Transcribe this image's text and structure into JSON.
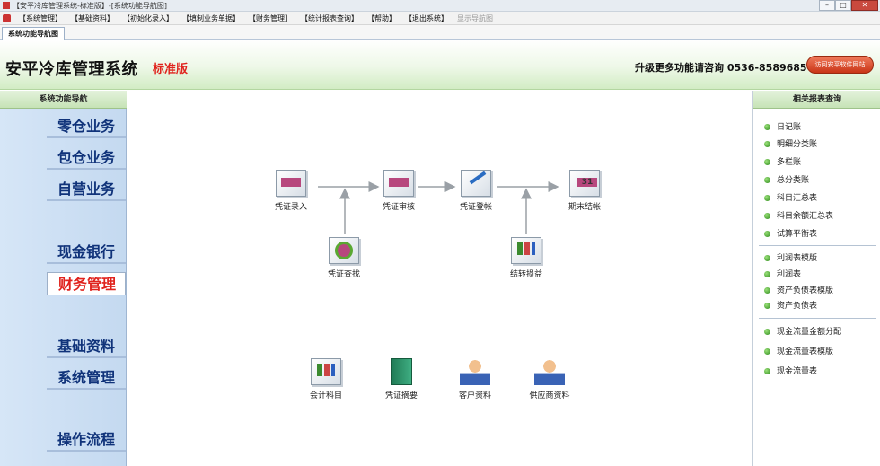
{
  "window": {
    "title": "【安平冷库管理系统-标准版】-[系统功能导航图]",
    "buttons": {
      "minimize": "–",
      "maximize": "□",
      "close": "✕"
    }
  },
  "menubar": {
    "items": [
      "【系统管理】",
      "【基础资料】",
      "【初始化录入】",
      "【填制业务单据】",
      "【财务管理】",
      "【统计报表查询】",
      "【帮助】",
      "【退出系统】",
      "显示导航图"
    ]
  },
  "tabs": {
    "active": "系统功能导航图"
  },
  "header": {
    "app_title": "安平冷库管理系统",
    "edition": "标准版",
    "phone_text": "升级更多功能请咨询 0536-8589685",
    "visit_button": "访问安平软件网站"
  },
  "left_nav": {
    "heading": "系统功能导航",
    "items": [
      "零仓业务",
      "包仓业务",
      "自营业务",
      "现金银行",
      "财务管理",
      "基础资料",
      "系统管理",
      "操作流程"
    ],
    "active": "财务管理"
  },
  "flow": {
    "nodes": {
      "voucher_entry": "凭证录入",
      "voucher_review": "凭证审核",
      "voucher_post": "凭证登帐",
      "period_close": "期末结帐",
      "voucher_query": "凭证查找",
      "carry_profit": "结转损益",
      "accounts": "会计科目",
      "voucher_summary": "凭证摘要",
      "customers": "客户资料",
      "suppliers": "供应商资料"
    },
    "icons": {
      "voucher_entry": "document-edit-icon",
      "voucher_review": "document-check-icon",
      "voucher_post": "pen-icon",
      "period_close": "calendar-icon",
      "voucher_query": "magnifier-icon",
      "carry_profit": "chart-icon",
      "accounts": "ledger-icon",
      "voucher_summary": "book-icon",
      "customers": "customer-icon",
      "suppliers": "supplier-icon"
    }
  },
  "right_panel": {
    "heading": "相关报表查询",
    "groups": [
      [
        "日记账",
        "明细分类账",
        "多栏账",
        "总分类账",
        "科目汇总表",
        "科目余额汇总表",
        "试算平衡表"
      ],
      [
        "利润表模版",
        "利润表",
        "资产负债表模版",
        "资产负债表"
      ],
      [
        "现金流量金额分配",
        "现金流量表模版",
        "现金流量表"
      ]
    ]
  },
  "colors": {
    "accent_red": "#e0231d",
    "nav_blue": "#10337a",
    "header_green": "#d2ecc4"
  }
}
